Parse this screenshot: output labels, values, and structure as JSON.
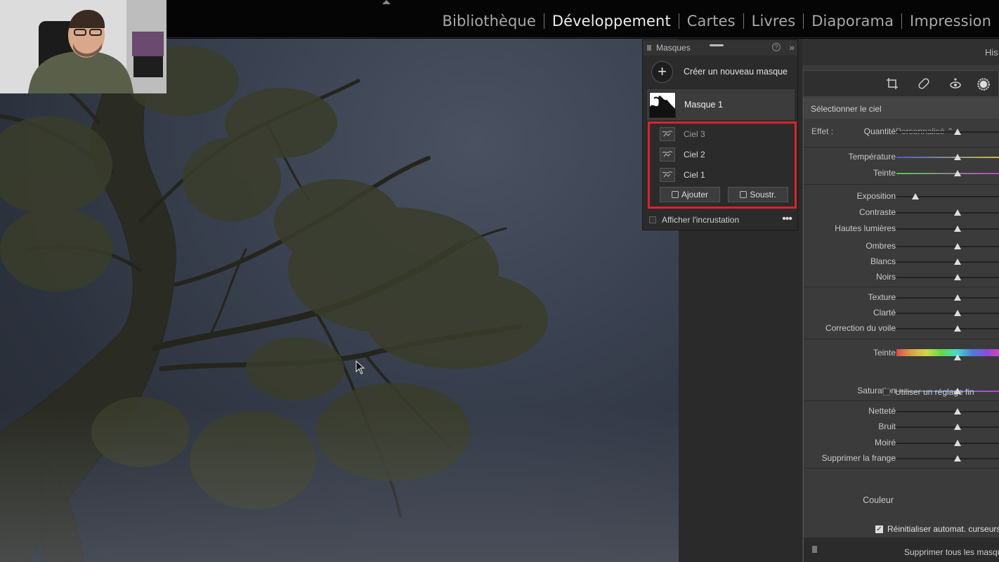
{
  "modules": {
    "items": [
      "Bibliothèque",
      "Développement",
      "Cartes",
      "Livres",
      "Diaporama",
      "Impression"
    ],
    "active": "Développement"
  },
  "masks_panel": {
    "title": "Masques",
    "create_label": "Créer un nouveau masque",
    "mask_name": "Masque 1",
    "components": [
      "Ciel 3",
      "Ciel 2",
      "Ciel 1"
    ],
    "add_label": "Ajouter",
    "subtract_label": "Soustr.",
    "overlay_label": "Afficher l'incrustation"
  },
  "right_panel": {
    "header_partial": "His",
    "selection_title": "Sélectionner le ciel",
    "effect_label": "Effet :",
    "effect_value": "Personnalisé",
    "sliders": [
      {
        "label": "Quantité",
        "value": 0.58
      },
      {
        "label": "Température",
        "value": 0.58
      },
      {
        "label": "Teinte",
        "value": 0.58
      },
      {
        "label": "Exposition",
        "value": 0.18
      },
      {
        "label": "Contraste",
        "value": 0.58
      },
      {
        "label": "Hautes lumières",
        "value": 0.58
      },
      {
        "label": "Ombres",
        "value": 0.58
      },
      {
        "label": "Blancs",
        "value": 0.58
      },
      {
        "label": "Noirs",
        "value": 0.58
      },
      {
        "label": "Texture",
        "value": 0.58
      },
      {
        "label": "Clarté",
        "value": 0.58
      },
      {
        "label": "Correction du voile",
        "value": 0.58
      },
      {
        "label": "Teinte",
        "value": 0.58
      },
      {
        "label": "Saturation",
        "value": 0.58
      },
      {
        "label": "Netteté",
        "value": 0.58
      },
      {
        "label": "Bruit",
        "value": 0.58
      },
      {
        "label": "Moiré",
        "value": 0.58
      },
      {
        "label": "Supprimer la frange",
        "value": 0.58
      }
    ],
    "fine_adjust_label": "Utiliser un réglage fin",
    "color_label": "Couleur",
    "reset_label": "Réinitialiser automat. curseurs",
    "delete_all_label": "Supprimer tous les masques"
  },
  "colors": {
    "highlight_border": "#d9232d",
    "background": "#000000",
    "panel": "#3b3b3b"
  }
}
